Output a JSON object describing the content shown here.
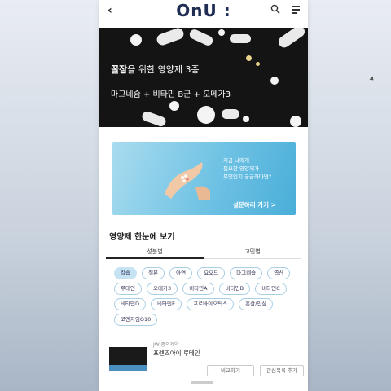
{
  "header": {
    "back_icon": "chevron-left-icon",
    "logo": "OnU :",
    "search_icon": "search-icon",
    "menu_icon": "menu-icon"
  },
  "hero": {
    "title_bold": "꿀잠",
    "title_rest": "을 위한 영양제 3종",
    "subtitle": "마그네슘 + 비타민 B군 + 오메가3"
  },
  "banner": {
    "line1": "지금 나에게",
    "line2": "필요한 영양제가",
    "line3": "무엇인지 궁금하다면?",
    "cta": "설문하러 가기 >"
  },
  "section": {
    "title": "영양제 한눈에 보기"
  },
  "tabs": [
    {
      "label": "성분별"
    },
    {
      "label": "고민별"
    }
  ],
  "chips": [
    {
      "label": "칼슘",
      "selected": true
    },
    {
      "label": "철분"
    },
    {
      "label": "아연"
    },
    {
      "label": "요오드"
    },
    {
      "label": "마그네슘"
    },
    {
      "label": "엽산"
    },
    {
      "label": "루테인"
    },
    {
      "label": "오메가3"
    },
    {
      "label": "비타민A"
    },
    {
      "label": "비타민B"
    },
    {
      "label": "비타민C"
    },
    {
      "label": "비타민D"
    },
    {
      "label": "비타민E"
    },
    {
      "label": "프로바이오틱스"
    },
    {
      "label": "홍삼/인삼"
    },
    {
      "label": "코엔자임Q10"
    }
  ],
  "product": {
    "brand": "JW 중외제약",
    "name": "프렌즈아이 루테인",
    "compare_button": "비교하기",
    "favorite_button": "관심목록 추가"
  },
  "colors": {
    "logo": "#1f2d55",
    "chip_selected": "#c6e3f3",
    "chip_border": "#a9cfe4",
    "banner": "#6fc2e4"
  }
}
